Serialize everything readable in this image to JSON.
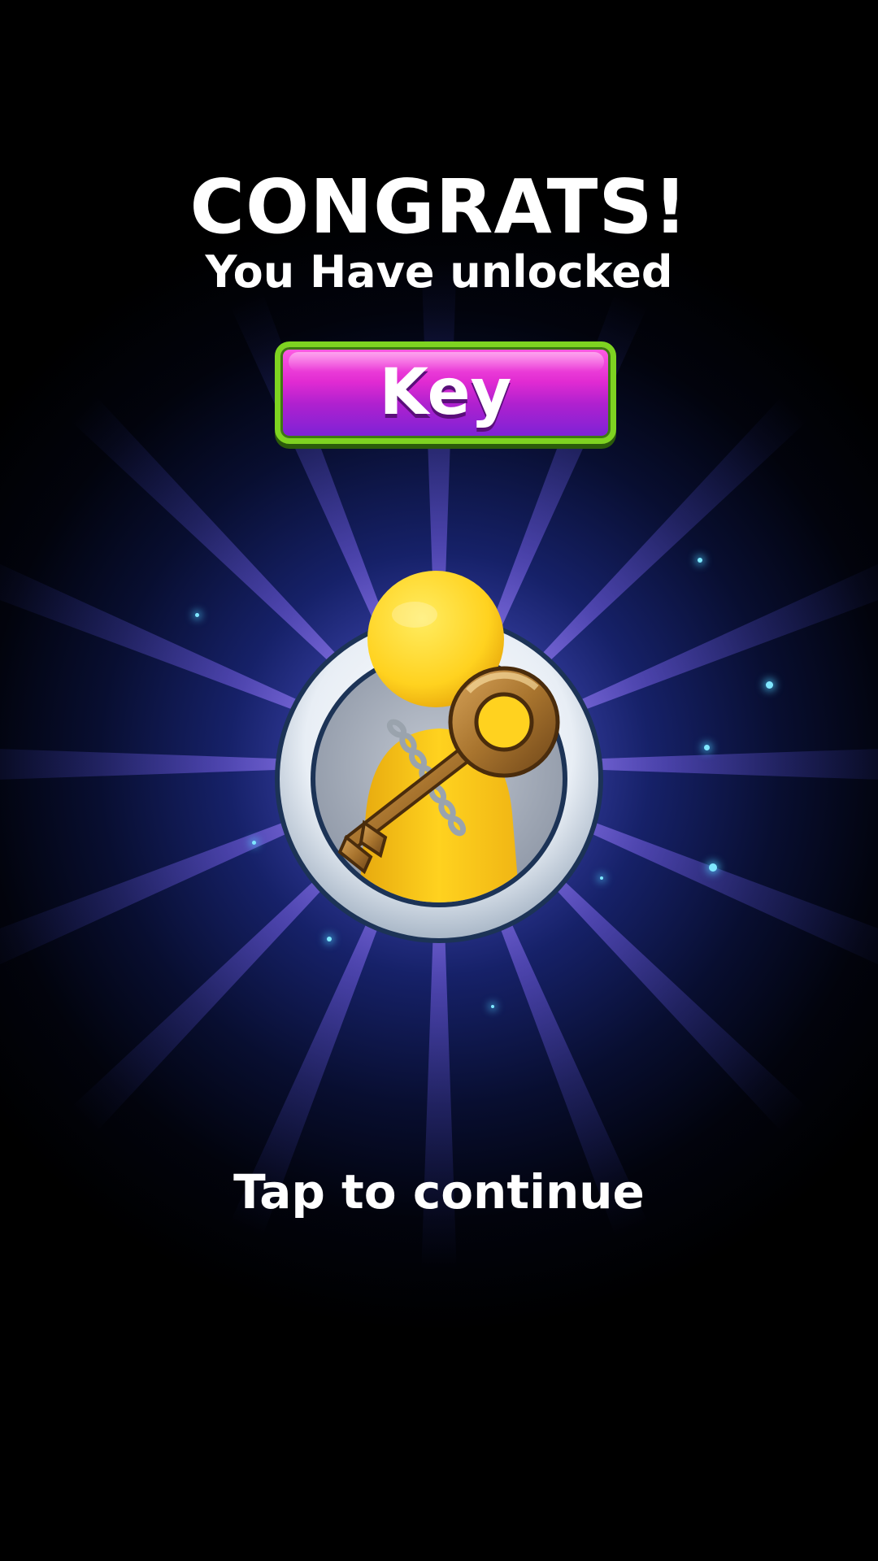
{
  "screen": {
    "title": "CONGRATS!",
    "subtitle": "You Have unlocked",
    "reward_label": "Key",
    "continue_prompt": "Tap to continue"
  },
  "reward": {
    "icon": "yellow-character-with-key-icon"
  },
  "colors": {
    "background": "#000000",
    "glow": "#5a5fe6",
    "banner_top": "#ff5fe3",
    "banner_bottom": "#7a22d6",
    "banner_border": "#7ed321",
    "character": "#ffd21f",
    "key": "#a8742e",
    "ring": "#e8eef5",
    "sparkle": "#7fe7ff"
  }
}
